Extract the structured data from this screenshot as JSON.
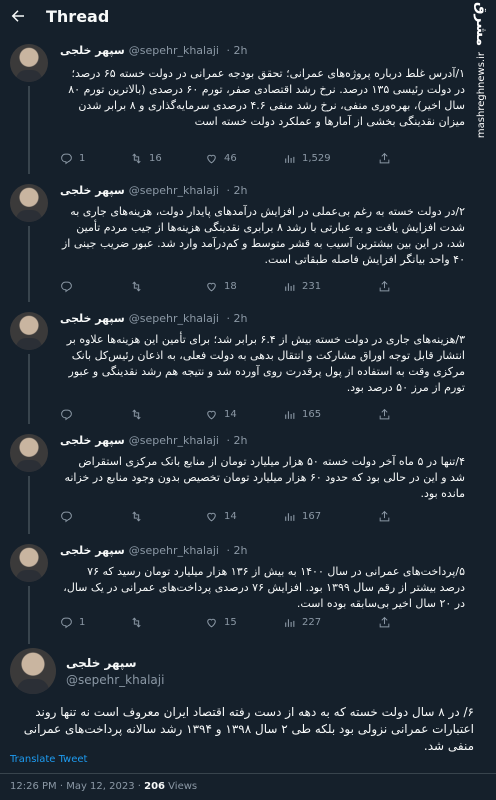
{
  "header": {
    "title": "Thread"
  },
  "watermark": {
    "logo": "مشرق",
    "site": "mashreghnews.ir"
  },
  "tweets": [
    {
      "name": "سپهر خلجی",
      "handle": "@sepehr_khalaji",
      "time": "· 2h",
      "text": "۱/آدرس غلط درباره پروژه‌های عمرانی؛ تحقق بودجه عمرانی در دولت خسته ۶۵ درصد؛ در دولت رئیسی ۱۳۵ درصد. نرخ رشد اقتصادی صفر، تورم ۶۰ درصدی (بالاترین تورم ۸۰ سال اخیر)، بهره‌وری منفی، نرخ رشد منفی ۴.۶ درصدی سرمایه‌گذاری و ۸ برابر شدن میزان نقدینگی بخشی از آمارها و عملکرد دولت خسته است",
      "replies": "1",
      "retweets": "16",
      "likes": "46",
      "views": "1,529"
    },
    {
      "name": "سپهر خلجی",
      "handle": "@sepehr_khalaji",
      "time": "· 2h",
      "text": "۲/در دولت خسته به رغم بی‌عملی در افزایش درآمدهای پایدار دولت، هزینه‌های جاری به شدت افزایش یافت و به عبارتی با رشد ۸ برابری نقدینگی هزینه‌ها از جیب مردم تأمین شد، در این بین بیشترین آسیب به قشر متوسط و کم‌درآمد وارد شد. عبور ضریب جینی از ۴۰ واحد بیانگر افزایش فاصله طبقاتی است.",
      "replies": "",
      "retweets": "",
      "likes": "18",
      "views": "231"
    },
    {
      "name": "سپهر خلجی",
      "handle": "@sepehr_khalaji",
      "time": "· 2h",
      "text": "۳/هزینه‌های جاری در دولت خسته بیش از ۶.۴ برابر شد؛ برای تأمین این هزینه‌ها علاوه بر انتشار قابل توجه اوراق مشارکت و انتقال بدهی به دولت فعلی، به اذعان رئیس‌کل بانک مرکزی وقت به استفاده از پول پرقدرت روی آورده شد و نتیجه هم رشد نقدینگی و عبور تورم از مرز ۵۰ درصد بود.",
      "replies": "",
      "retweets": "",
      "likes": "14",
      "views": "165"
    },
    {
      "name": "سپهر خلجی",
      "handle": "@sepehr_khalaji",
      "time": "· 2h",
      "text": "۴/تنها در ۵ ماه آخر دولت خسته ۵۰ هزار میلیارد تومان از منابع بانک مرکزی استقراض شد و این در حالی بود که حدود ۶۰ هزار میلیارد تومان تخصیص بدون وجود منابع در خزانه مانده بود.",
      "replies": "",
      "retweets": "",
      "likes": "14",
      "views": "167"
    },
    {
      "name": "سپهر خلجی",
      "handle": "@sepehr_khalaji",
      "time": "· 2h",
      "text": "۵/پرداخت‌های عمرانی در سال ۱۴۰۰ به بیش از ۱۳۶ هزار میلیارد تومان رسید که ۷۶ درصد بیشتر از رقم سال ۱۳۹۹ بود. افزایش ۷۶ درصدی پرداخت‌های عمرانی در یک سال، در ۲۰ سال اخیر بی‌سابقه بوده است.",
      "replies": "1",
      "retweets": "",
      "likes": "15",
      "views": "227"
    }
  ],
  "final": {
    "name": "سپهر خلجی",
    "handle": "@sepehr_khalaji",
    "text": "۶/ در ۸ سال دولت خسته که به دهه از دست رفته اقتصاد ایران معروف است نه تنها روند اعتبارات عمرانی نزولی بود بلکه طی ۲ سال ۱۳۹۸ و ۱۳۹۴ رشد سالانه پرداخت‌های عمرانی منفی شد.",
    "translate": "Translate Tweet",
    "time": "12:26 PM · May 12, 2023 · ",
    "views_count": "206",
    "views_label": " Views"
  }
}
